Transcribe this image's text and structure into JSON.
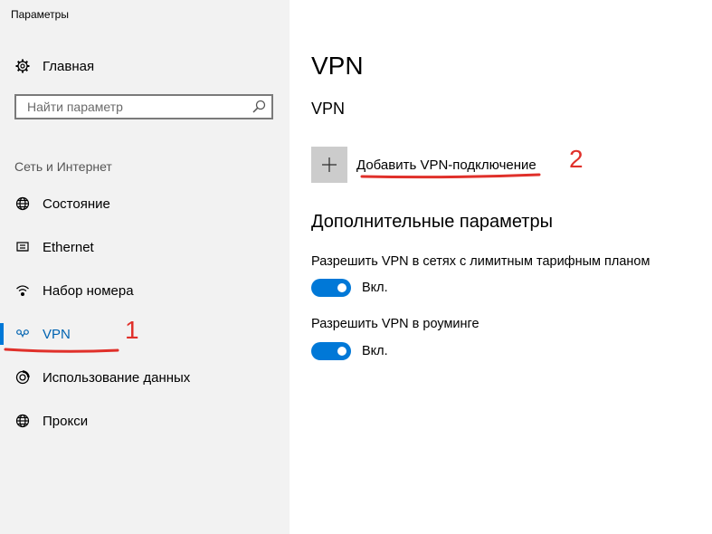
{
  "window": {
    "title": "Параметры"
  },
  "sidebar": {
    "home_label": "Главная",
    "search_placeholder": "Найти параметр",
    "section_label": "Сеть и Интернет",
    "items": [
      {
        "label": "Состояние",
        "icon": "globe-icon",
        "active": false
      },
      {
        "label": "Ethernet",
        "icon": "ethernet-icon",
        "active": false
      },
      {
        "label": "Набор номера",
        "icon": "dialup-icon",
        "active": false
      },
      {
        "label": "VPN",
        "icon": "vpn-icon",
        "active": true
      },
      {
        "label": "Использование данных",
        "icon": "data-usage-icon",
        "active": false
      },
      {
        "label": "Прокси",
        "icon": "globe-icon",
        "active": false
      }
    ]
  },
  "main": {
    "title": "VPN",
    "subheading": "VPN",
    "add_vpn_label": "Добавить VPN-подключение",
    "advanced_heading": "Дополнительные параметры",
    "options": [
      {
        "label": "Разрешить VPN в сетях с лимитным тарифным планом",
        "state": "Вкл.",
        "on": true
      },
      {
        "label": "Разрешить VPN в роуминге",
        "state": "Вкл.",
        "on": true
      }
    ]
  },
  "annotations": {
    "num1": "1",
    "num2": "2",
    "color": "#e0302a"
  },
  "colors": {
    "accent": "#0078d7",
    "active_text": "#0063b1",
    "sidebar_bg": "#f2f2f2"
  }
}
